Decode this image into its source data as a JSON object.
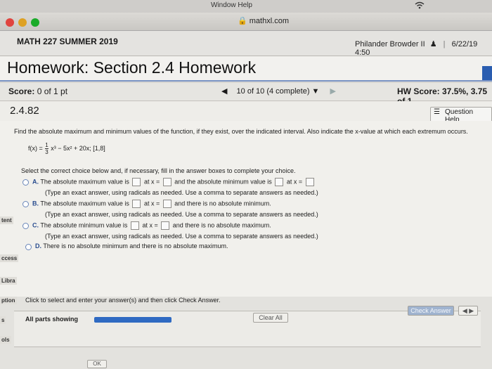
{
  "menubar": {
    "menus": "Window   Help"
  },
  "browser": {
    "url": "mathxl.com"
  },
  "course": {
    "title": "MATH 227 SUMMER 2019",
    "user": "Philander Browder II",
    "separator": "|",
    "datetime": "6/22/19 4:50"
  },
  "homework": {
    "title": "Homework: Section 2.4 Homework"
  },
  "score": {
    "label": "Score:",
    "value": "0 of 1 pt",
    "progress": "10 of 10 (4 complete)",
    "hw_score": "HW Score: 37.5%, 3.75 of 1"
  },
  "question": {
    "id": "2.4.82",
    "help_label": "Question Help",
    "prompt": "Find the absolute maximum and minimum values of the function, if they exist, over the indicated interval. Also indicate the x-value at which each extremum occurs.",
    "function_lhs": "f(x) =",
    "fraction_num": "1",
    "fraction_den": "3",
    "function_rest": "x³ − 5x² + 20x; [1,8]",
    "instruction": "Select the correct choice below and, if necessary, fill in the answer boxes to complete your choice.",
    "options": [
      {
        "letter": "A.",
        "line1a": "The absolute maximum value is",
        "line1b": "at x =",
        "line1c": "and the absolute minimum value is",
        "line1d": "at x =",
        "line2": "(Type an exact answer, using radicals as needed. Use a comma to separate answers as needed.)"
      },
      {
        "letter": "B.",
        "line1a": "The absolute maximum value is",
        "line1b": "at x =",
        "line1c": "and there is no absolute minimum.",
        "line2": "(Type an exact answer, using radicals as needed. Use a comma to separate answers as needed.)"
      },
      {
        "letter": "C.",
        "line1a": "The absolute minimum value is",
        "line1b": "at x =",
        "line1c": "and there is no absolute maximum.",
        "line2": "(Type an exact answer, using radicals as needed. Use a comma to separate answers as needed.)"
      },
      {
        "letter": "D.",
        "line1a": "There is no absolute minimum and there is no absolute maximum."
      }
    ]
  },
  "side_labels": [
    "tent",
    "ccess",
    "Libra",
    "ption",
    "s",
    "ols"
  ],
  "bottom": {
    "click_text": "Click to select and enter your answer(s) and then click Check Answer.",
    "all_parts": "All parts showing",
    "clear_all": "Clear All",
    "check_answer": "Check Answer",
    "ok": "OK"
  }
}
